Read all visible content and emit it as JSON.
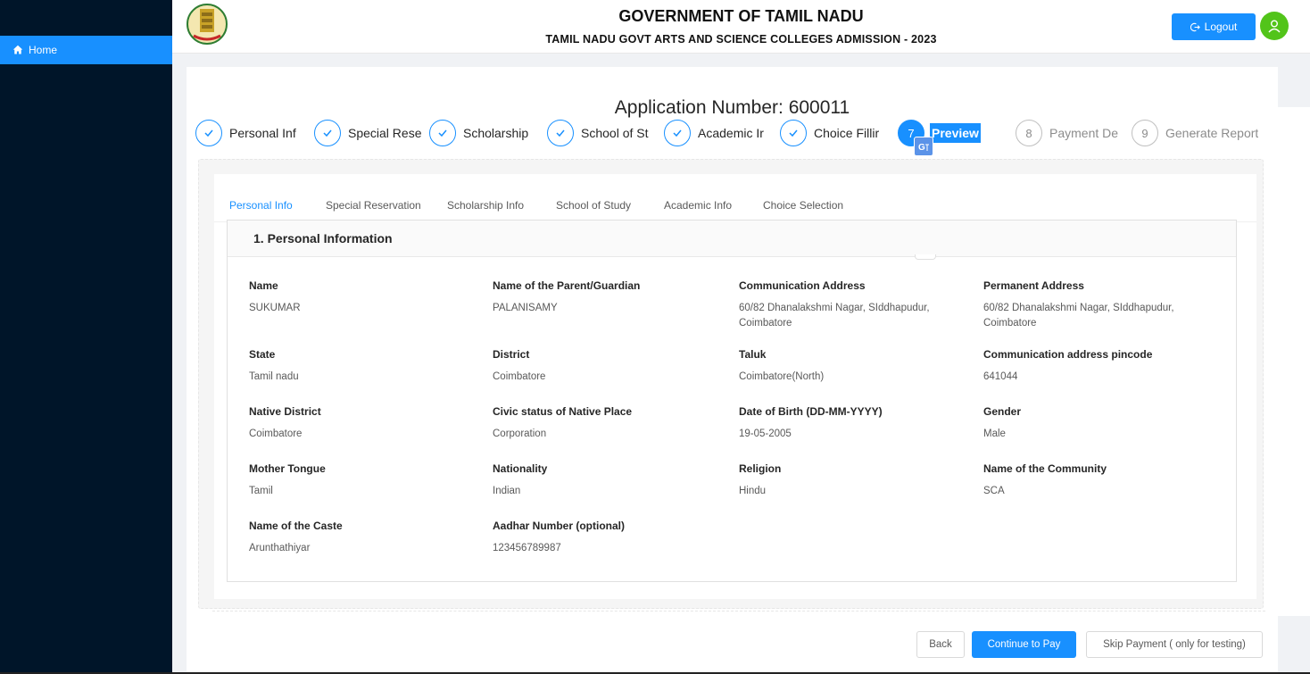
{
  "sidebar": {
    "home_label": "Home"
  },
  "header": {
    "title": "GOVERNMENT OF TAMIL NADU",
    "subtitle": "TAMIL NADU GOVT ARTS AND SCIENCE COLLEGES ADMISSION - 2023",
    "logout_label": "Logout"
  },
  "application": {
    "number_label": "Application Number: 600011"
  },
  "steps": [
    {
      "label": "Personal Inf",
      "status": "done"
    },
    {
      "label": "Special Rese",
      "status": "done"
    },
    {
      "label": "Scholarship",
      "status": "done"
    },
    {
      "label": "School of St",
      "status": "done"
    },
    {
      "label": "Academic Ir",
      "status": "done"
    },
    {
      "label": "Choice Fillir",
      "status": "done"
    },
    {
      "number": "7",
      "label": "Preview",
      "status": "active"
    },
    {
      "number": "8",
      "label": "Payment De",
      "status": "todo"
    },
    {
      "number": "9",
      "label": "Generate Report",
      "status": "todo"
    }
  ],
  "tabs": [
    "Personal Info",
    "Special Reservation",
    "Scholarship Info",
    "School of Study",
    "Academic Info",
    "Choice Selection"
  ],
  "personal": {
    "heading": "1. Personal Information",
    "fields": [
      {
        "label": "Name",
        "value": "SUKUMAR"
      },
      {
        "label": "Name of the Parent/Guardian",
        "value": "PALANISAMY"
      },
      {
        "label": "Communication Address",
        "value": "60/82 Dhanalakshmi Nagar, SIddhapudur, Coimbatore"
      },
      {
        "label": "Permanent Address",
        "value": "60/82 Dhanalakshmi Nagar, SIddhapudur, Coimbatore"
      },
      {
        "label": "State",
        "value": "Tamil nadu"
      },
      {
        "label": "District",
        "value": "Coimbatore"
      },
      {
        "label": "Taluk",
        "value": "Coimbatore(North)"
      },
      {
        "label": "Communication address pincode",
        "value": "641044"
      },
      {
        "label": "Native District",
        "value": "Coimbatore"
      },
      {
        "label": "Civic status of Native Place",
        "value": "Corporation"
      },
      {
        "label": "Date of Birth (DD-MM-YYYY)",
        "value": "19-05-2005"
      },
      {
        "label": "Gender",
        "value": "Male"
      },
      {
        "label": "Mother Tongue",
        "value": "Tamil"
      },
      {
        "label": "Nationality",
        "value": "Indian"
      },
      {
        "label": "Religion",
        "value": "Hindu"
      },
      {
        "label": "Name of the Community",
        "value": "SCA"
      },
      {
        "label": "Name of the Caste",
        "value": "Arunthathiyar"
      },
      {
        "label": "Aadhar Number (optional)",
        "value": "123456789987"
      }
    ]
  },
  "footer": {
    "back_label": "Back",
    "pay_label": "Continue to Pay",
    "skip_label": "Skip Payment ( only for testing)"
  },
  "colors": {
    "primary": "#1890ff",
    "sidebar": "#001529",
    "avatar": "#52c41a"
  }
}
